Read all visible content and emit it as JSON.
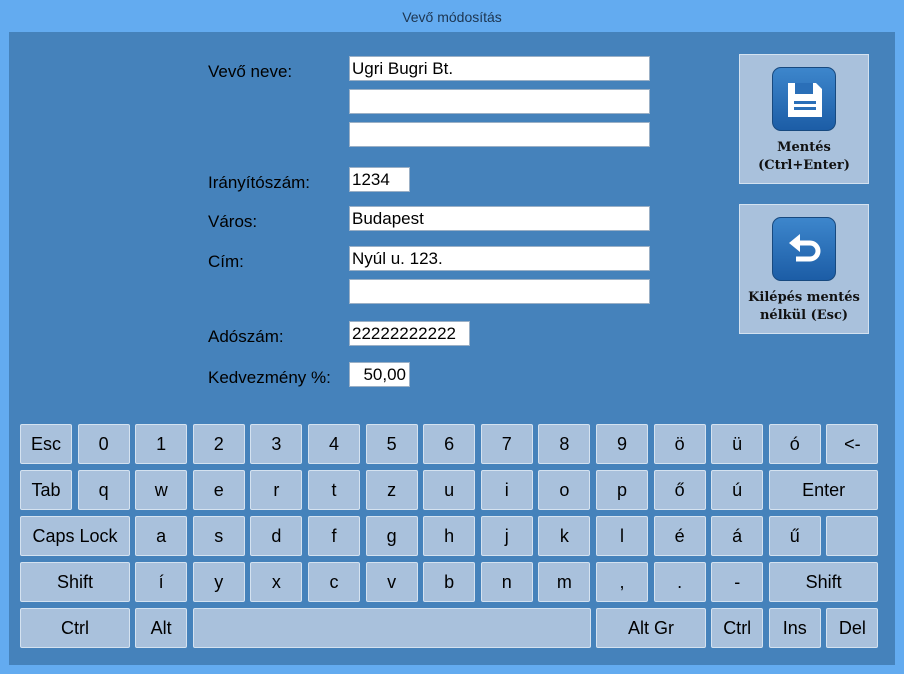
{
  "window": {
    "title": "Vevő módosítás"
  },
  "form": {
    "name_label": "Vevő neve:",
    "name_lines": [
      "Ugri Bugri Bt.",
      "",
      ""
    ],
    "zip_label": "Irányítószám:",
    "zip": "1234",
    "city_label": "Város:",
    "city": "Budapest",
    "address_label": "Cím:",
    "address_lines": [
      "Nyúl u. 123.",
      ""
    ],
    "tax_label": "Adószám:",
    "tax": "22222222222",
    "discount_label": "Kedvezmény %:",
    "discount": "50,00"
  },
  "buttons": {
    "save": {
      "line1": "Mentés",
      "line2": "(Ctrl+Enter)",
      "icon": "floppy-disk-icon"
    },
    "exit": {
      "line1": "Kilépés mentés",
      "line2": "nélkül (Esc)",
      "icon": "undo-arrow-icon"
    }
  },
  "keyboard": {
    "row1": [
      "Esc",
      "0",
      "1",
      "2",
      "3",
      "4",
      "5",
      "6",
      "7",
      "8",
      "9",
      "ö",
      "ü",
      "ó",
      "<-"
    ],
    "row2": [
      "Tab",
      "q",
      "w",
      "e",
      "r",
      "t",
      "z",
      "u",
      "i",
      "o",
      "p",
      "ő",
      "ú",
      "Enter"
    ],
    "row3": [
      "Caps Lock",
      "a",
      "s",
      "d",
      "f",
      "g",
      "h",
      "j",
      "k",
      "l",
      "é",
      "á",
      "ű",
      ""
    ],
    "row4": [
      "Shift",
      "í",
      "y",
      "x",
      "c",
      "v",
      "b",
      "n",
      "m",
      ",",
      ".",
      "-",
      "Shift"
    ],
    "row5": [
      "Ctrl",
      "Alt",
      "",
      "Alt Gr",
      "Ctrl",
      "Ins",
      "Del"
    ]
  },
  "colors": {
    "window_border": "#63abf0",
    "panel": "#4582bb",
    "key": "#a9c1dc"
  }
}
